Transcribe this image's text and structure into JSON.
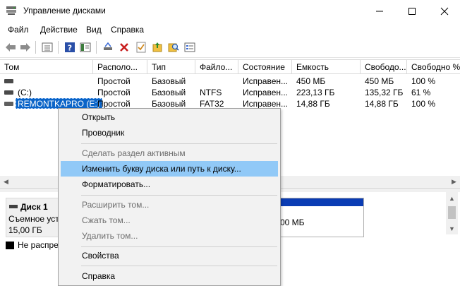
{
  "window": {
    "title": "Управление дисками"
  },
  "menu": [
    "Файл",
    "Действие",
    "Вид",
    "Справка"
  ],
  "toolbar": {
    "icons": [
      "back-arrow-icon",
      "forward-arrow-icon",
      "properties-list-icon",
      "help-icon",
      "console-tree-icon",
      "connect-disk-icon",
      "delete-icon",
      "check-icon",
      "rescan-icon",
      "search-icon",
      "details-icon"
    ]
  },
  "volumes": {
    "columns": [
      "Том",
      "Располо...",
      "Тип",
      "Файло...",
      "Состояние",
      "Емкость",
      "Свободо...",
      "Свободно %"
    ],
    "rows": [
      {
        "name": "",
        "layout": "Простой",
        "type": "Базовый",
        "fs": "",
        "status": "Исправен...",
        "capacity": "450 МБ",
        "free": "450 МБ",
        "free_pct": "100 %"
      },
      {
        "name": "(C:)",
        "layout": "Простой",
        "type": "Базовый",
        "fs": "NTFS",
        "status": "Исправен...",
        "capacity": "223,13 ГБ",
        "free": "135,32 ГБ",
        "free_pct": "61 %"
      },
      {
        "name": "REMONTKAPRO (E:)",
        "layout": "Простой",
        "type": "Базовый",
        "fs": "FAT32",
        "status": "Исправен...",
        "capacity": "14,88 ГБ",
        "free": "14,88 ГБ",
        "free_pct": "100 %"
      }
    ]
  },
  "disk": {
    "title": "Диск 1",
    "kind": "Съемное уст",
    "size": "15,00 ГБ",
    "partition_size_fragment": "00 МБ",
    "legend_unallocated": "Не распре"
  },
  "context_menu": {
    "items": [
      {
        "label": "Открыть",
        "enabled": true
      },
      {
        "label": "Проводник",
        "enabled": true
      },
      {
        "label": "Сделать раздел активным",
        "enabled": false
      },
      {
        "label": "Изменить букву диска или путь к диску...",
        "enabled": true,
        "highlighted": true
      },
      {
        "label": "Форматировать...",
        "enabled": true
      },
      {
        "label": "Расширить том...",
        "enabled": false
      },
      {
        "label": "Сжать том...",
        "enabled": false
      },
      {
        "label": "Удалить том...",
        "enabled": false
      },
      {
        "label": "Свойства",
        "enabled": true
      },
      {
        "label": "Справка",
        "enabled": true
      }
    ]
  },
  "colors": {
    "selection": "#0a64c8",
    "menu_highlight": "#91c9f7",
    "partition_bar": "#0a3cb4"
  }
}
